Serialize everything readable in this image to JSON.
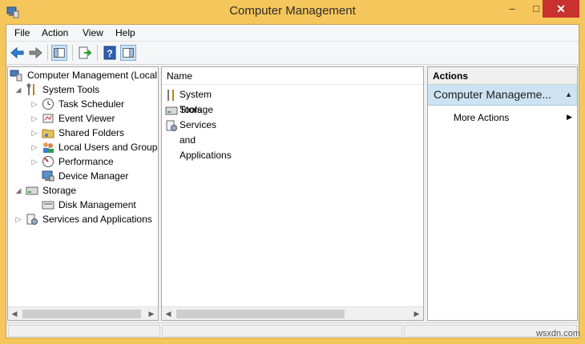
{
  "window": {
    "title": "Computer Management",
    "controls": {
      "minimize": "–",
      "maximize": "□",
      "close": "✕"
    }
  },
  "menu": {
    "file": "File",
    "action": "Action",
    "view": "View",
    "help": "Help"
  },
  "toolbar": {
    "icons": [
      "back-arrow-icon",
      "forward-arrow-icon",
      "show-hide-console-tree-icon",
      "export-list-icon",
      "help-icon",
      "show-hide-action-pane-icon"
    ]
  },
  "tree": {
    "root": "Computer Management (Local",
    "system_tools": "System Tools",
    "task_scheduler": "Task Scheduler",
    "event_viewer": "Event Viewer",
    "shared_folders": "Shared Folders",
    "local_users": "Local Users and Groups",
    "performance": "Performance",
    "device_manager": "Device Manager",
    "storage": "Storage",
    "disk_management": "Disk Management",
    "services": "Services and Applications"
  },
  "list": {
    "header": "Name",
    "rows": [
      "System Tools",
      "Storage",
      "Services and Applications"
    ]
  },
  "actions": {
    "header": "Actions",
    "section": "Computer Manageme...",
    "more": "More Actions"
  },
  "watermark": "wsxdn.com",
  "colors": {
    "title_bar": "#f5c65b",
    "close_button": "#c7312e",
    "selection": "#cde3f3"
  }
}
